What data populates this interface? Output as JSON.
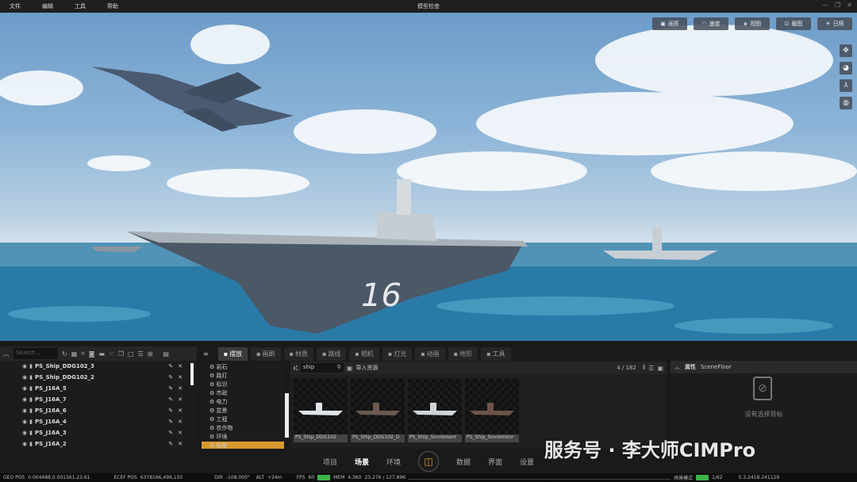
{
  "menu": [
    "文件",
    "编辑",
    "工具",
    "帮助"
  ],
  "window_title": "模型检查",
  "top_buttons": [
    {
      "icon": "image-icon",
      "label": "画质"
    },
    {
      "icon": "speed-icon",
      "label": "速度"
    },
    {
      "icon": "view-icon",
      "label": "视图"
    },
    {
      "icon": "screenshot-icon",
      "label": "截图"
    },
    {
      "icon": "sun-icon",
      "label": "日照"
    }
  ],
  "outliner": {
    "search_placeholder": "Search...",
    "items": [
      "PS_Ship_DDG102_3",
      "PS_Ship_DDG102_2",
      "PS_J16A_5",
      "PS_J16A_7",
      "PS_J16A_6",
      "PS_J16A_4",
      "PS_J16A_3",
      "PS_J16A_2"
    ]
  },
  "tabs": [
    {
      "label": "摆放",
      "active": true
    },
    {
      "label": "画刷"
    },
    {
      "label": "材质"
    },
    {
      "label": "路线"
    },
    {
      "label": "相机"
    },
    {
      "label": "灯光"
    },
    {
      "label": "动画"
    },
    {
      "label": "地形"
    },
    {
      "label": "工具"
    }
  ],
  "categories": [
    "岩石",
    "路灯",
    "标识",
    "市政",
    "电力",
    "盆景",
    "工程",
    "农作物",
    "环境",
    "船舶"
  ],
  "assets": {
    "search_value": "ship",
    "import_label": "导入资源",
    "count": "4 / 182",
    "items": [
      "PS_Ship_DDG102",
      "PS_Ship_DDG102_D",
      "PS_Ship_Sovremenr",
      "PS_Ship_Sovremenr"
    ]
  },
  "properties": {
    "title": "属性",
    "subject": "SceneFloor",
    "empty_text": "没有选择目标"
  },
  "nav": [
    {
      "label": "项目"
    },
    {
      "label": "场景",
      "active": true
    },
    {
      "label": "环境"
    },
    {
      "label": "数据"
    },
    {
      "label": "界面"
    },
    {
      "label": "设置"
    }
  ],
  "status": {
    "geo_label": "GEO POS",
    "geo": "0.004488,0.001361,23.61",
    "ecef_label": "ECEF POS",
    "ecef": "6378166,499,150",
    "dir_label": "DIR",
    "dir": "-108.000°",
    "alt_label": "ALT",
    "alt": "+24m",
    "fps_label": "FPS",
    "fps": "60",
    "mem_label": "MEM",
    "mem": "4.360",
    "mem2": "23.276 / 127.896",
    "mode": "场景模式",
    "page": "1/62",
    "version": "5.3.2418.241129"
  },
  "watermark": "服务号 · 李大师CIMPro",
  "scene": {
    "hull_number": "16"
  }
}
